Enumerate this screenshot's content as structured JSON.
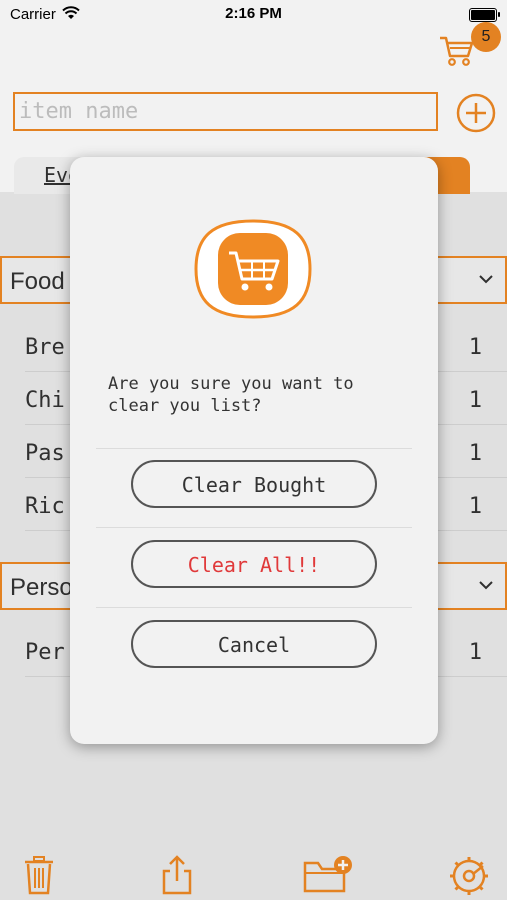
{
  "status_bar": {
    "carrier": "Carrier",
    "time": "2:16 PM"
  },
  "header": {
    "cart_badge": "5",
    "item_input_placeholder": "item name"
  },
  "tabs": [
    {
      "label": "Eve"
    }
  ],
  "categories": [
    {
      "label": "Food",
      "items": [
        {
          "name": "Bre",
          "qty": "1"
        },
        {
          "name": "Chi",
          "qty": "1"
        },
        {
          "name": "Pas",
          "qty": "1"
        },
        {
          "name": "Ric",
          "qty": "1"
        }
      ]
    },
    {
      "label": "Perso",
      "items": [
        {
          "name": "Per",
          "qty": "1"
        }
      ]
    }
  ],
  "dialog": {
    "message": "Are you sure you want to\nclear you list?",
    "buttons": {
      "clear_bought": "Clear Bought",
      "clear_all": "Clear All!!",
      "cancel": "Cancel"
    }
  },
  "toolbar": {
    "icons": [
      "trash-icon",
      "share-icon",
      "folder-add-icon",
      "settings-icon"
    ]
  },
  "colors": {
    "accent": "#f08a24",
    "danger": "#e0393a",
    "background": "#ededed"
  }
}
